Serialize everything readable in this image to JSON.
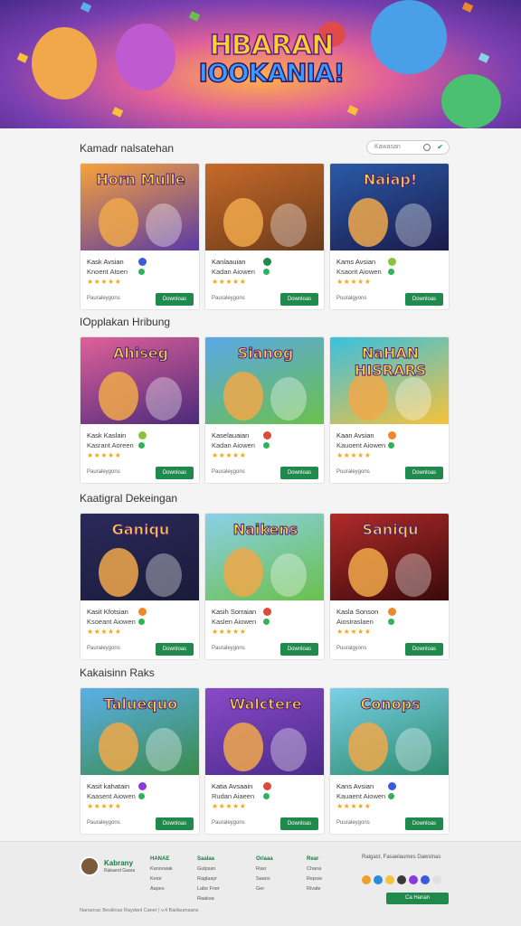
{
  "hero": {
    "title_line1": "HBARAN",
    "title_line2": "IOOKANIA!"
  },
  "search": {
    "placeholder": "Kawasan"
  },
  "sections": [
    {
      "title": "Kamadr nalsatehan",
      "cards": [
        {
          "art": "Horn Mulle",
          "line1": "Kask Avsian",
          "line2": "Knoent Atoen",
          "meta": "Pauraleygons",
          "button": "Downloas",
          "colors": [
            "#f7a23a",
            "#5a3aa6"
          ],
          "dot": "#3a5adf"
        },
        {
          "art": "",
          "line1": "Kanlaauian",
          "line2": "Kadan Aiowen",
          "meta": "Pauraleygons",
          "button": "Downloas",
          "colors": [
            "#c76a2a",
            "#6a3a1a"
          ],
          "dot": "#1f8a4c"
        },
        {
          "art": "Naiap!",
          "line1": "Kams Avsian",
          "line2": "Ksaorit Aiowen",
          "meta": "Puuralgyons",
          "button": "Downloas",
          "colors": [
            "#2a5aa8",
            "#1a1a4a"
          ],
          "dot": "#8ac23a"
        }
      ]
    },
    {
      "title": "IOpplakan Hribung",
      "cards": [
        {
          "art": "Ahiseg",
          "line1": "Kask Kaslain",
          "line2": "Kasrant Aoreen",
          "meta": "Pauraleygons",
          "button": "Downloas",
          "colors": [
            "#e0609a",
            "#4a2a7a"
          ],
          "dot": "#8ac23a"
        },
        {
          "art": "Sianog",
          "line1": "Kaselauaian",
          "line2": "Kadan Aiowen",
          "meta": "Pauraleygons",
          "button": "Downloas",
          "colors": [
            "#5aa8e8",
            "#6ac04a"
          ],
          "dot": "#e04a3a"
        },
        {
          "art": "NaHAN HISRARS",
          "line1": "Kaan Avsian",
          "line2": "Kauoent Aiowen",
          "meta": "Puuraleygons",
          "button": "Downloas",
          "colors": [
            "#3ac0e0",
            "#f7c23a"
          ],
          "dot": "#f0882a"
        }
      ]
    },
    {
      "title": "Kaatigral Dekeingan",
      "cards": [
        {
          "art": "Ganiqu",
          "line1": "Kasit Kfotsian",
          "line2": "Ksoeant Aiowen",
          "meta": "Pauraleygons",
          "button": "Downloas",
          "colors": [
            "#2a2a5a",
            "#1a1a3a"
          ],
          "dot": "#f0882a"
        },
        {
          "art": "Naikens",
          "line1": "Kasih Sorraian",
          "line2": "Kaslen Aiowen",
          "meta": "Pauraleygons",
          "button": "Downloas",
          "colors": [
            "#8ad0e8",
            "#6ac04a"
          ],
          "dot": "#e04a3a"
        },
        {
          "art": "Saniqu",
          "line1": "Kasla Sonson",
          "line2": "Aiosiraslaen",
          "meta": "Puuralgyons",
          "button": "Downloas",
          "colors": [
            "#b02a2a",
            "#3a0a0a"
          ],
          "dot": "#f0882a"
        }
      ]
    },
    {
      "title": "Kakaisinn Raks",
      "cards": [
        {
          "art": "Taluequo",
          "line1": "Kasit kahatain",
          "line2": "Kaasent Aiowen",
          "meta": "Pauraleygons",
          "button": "Downloas",
          "colors": [
            "#5ab0e8",
            "#3a8a4a"
          ],
          "dot": "#8a3adf"
        },
        {
          "art": "Walctere",
          "line1": "Katia Avsaain",
          "line2": "Rudan Aiaeen",
          "meta": "Pauraleygons",
          "button": "Downloas",
          "colors": [
            "#8a4ac8",
            "#4a2a8a"
          ],
          "dot": "#e04a3a"
        },
        {
          "art": "Conops",
          "line1": "Kans Avsian",
          "line2": "Kauaent Aiowen",
          "meta": "Puuraleygons",
          "button": "Downloas",
          "colors": [
            "#7ad0e8",
            "#2a8a6a"
          ],
          "dot": "#3a5adf"
        }
      ]
    }
  ],
  "footer": {
    "brand": "Kabrany",
    "sub": "Rakaerd Gaara",
    "columns": [
      {
        "head": "HANAE",
        "items": [
          "Kanoraiak",
          "Keior",
          "Aapes"
        ]
      },
      {
        "head": "Saalaa",
        "items": [
          "Gulpsan",
          "Raglaayr",
          "Labs Fner",
          "Raaksa"
        ]
      },
      {
        "head": "Oriaaa",
        "items": [
          "Rasr",
          "Saans",
          "Ger"
        ]
      },
      {
        "head": "Rear",
        "items": [
          "Chana",
          "Repow",
          "Rivate"
        ]
      }
    ],
    "right_text": "Raigast, Fasaelaumes Dawslnas",
    "icon_colors": [
      "#f0a02a",
      "#2a8ae0",
      "#f7c23a",
      "#3a3a3a",
      "#8a3adf",
      "#3a5adf",
      "#e0e0e0"
    ],
    "button": "Ca Hanan",
    "copyright": "Nanaorac Besilinas Raydanl Caner | v.4 Baiilaumaans"
  }
}
